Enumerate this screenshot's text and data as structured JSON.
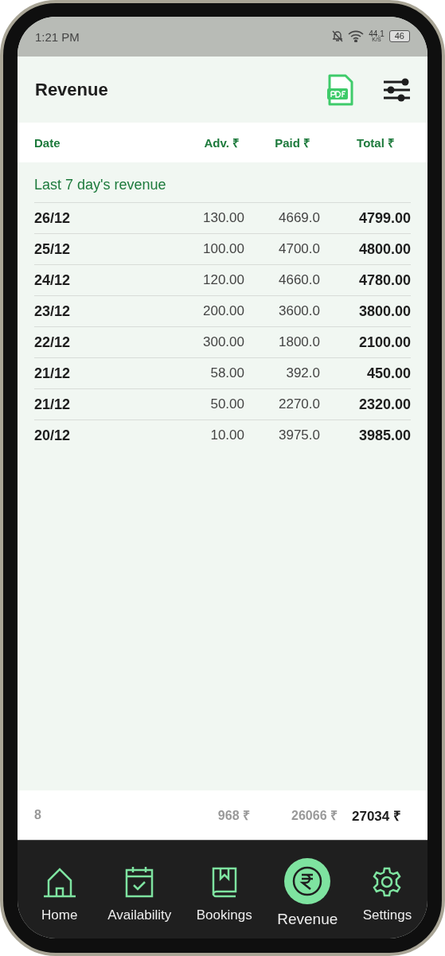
{
  "status_bar": {
    "time": "1:21 PM",
    "speed": "44.1",
    "speed_unit": "K/S",
    "battery": "46"
  },
  "header": {
    "title": "Revenue"
  },
  "table": {
    "columns": [
      "Date",
      "Adv. ₹",
      "Paid ₹",
      "Total ₹"
    ],
    "section": "Last 7 day's revenue",
    "rows": [
      {
        "date": "26/12",
        "adv": "130.00",
        "paid": "4669.0",
        "total": "4799.00"
      },
      {
        "date": "25/12",
        "adv": "100.00",
        "paid": "4700.0",
        "total": "4800.00"
      },
      {
        "date": "24/12",
        "adv": "120.00",
        "paid": "4660.0",
        "total": "4780.00"
      },
      {
        "date": "23/12",
        "adv": "200.00",
        "paid": "3600.0",
        "total": "3800.00"
      },
      {
        "date": "22/12",
        "adv": "300.00",
        "paid": "1800.0",
        "total": "2100.00"
      },
      {
        "date": "21/12",
        "adv": "58.00",
        "paid": "392.0",
        "total": "450.00"
      },
      {
        "date": "21/12",
        "adv": "50.00",
        "paid": "2270.0",
        "total": "2320.00"
      },
      {
        "date": "20/12",
        "adv": "10.00",
        "paid": "3975.0",
        "total": "3985.00"
      }
    ],
    "totals": {
      "count": "8",
      "adv": "968 ₹",
      "paid": "26066 ₹",
      "total": "27034 ₹"
    }
  },
  "nav": [
    {
      "kind": "home",
      "label": "Home",
      "selected": false
    },
    {
      "kind": "calendar",
      "label": "Availability",
      "selected": false
    },
    {
      "kind": "book",
      "label": "Bookings",
      "selected": false
    },
    {
      "kind": "rupee",
      "label": "Revenue",
      "selected": true
    },
    {
      "kind": "gear",
      "label": "Settings",
      "selected": false
    }
  ]
}
